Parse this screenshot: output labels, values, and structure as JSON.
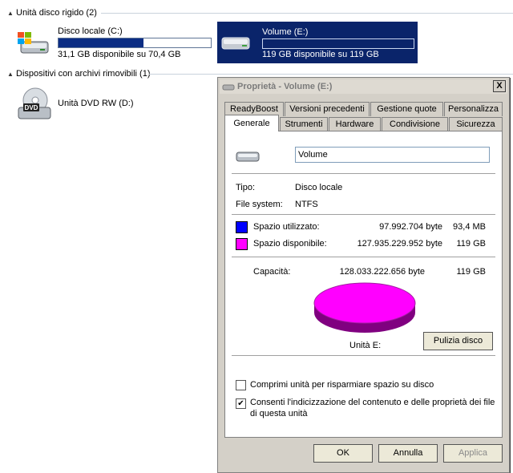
{
  "explorer": {
    "groups": [
      {
        "title": "Unità disco rigido (2)"
      },
      {
        "title": "Dispositivi con archivi rimovibili (1)"
      }
    ],
    "drives": [
      {
        "name": "Disco locale (C:)",
        "space": "31,1 GB disponibile su 70,4 GB",
        "used_fraction": 0.56
      },
      {
        "name": "Volume (E:)",
        "space": "119 GB disponibile su 119 GB",
        "used_fraction": 0.0
      },
      {
        "name": "Unità DVD RW (D:)",
        "icon_label": "DVD"
      }
    ]
  },
  "dialog": {
    "title": "Proprietà - Volume (E:)",
    "close_label": "X",
    "tabs_row1": [
      "ReadyBoost",
      "Versioni precedenti",
      "Gestione quote",
      "Personalizza"
    ],
    "tabs_row2": [
      "Generale",
      "Strumenti",
      "Hardware",
      "Condivisione",
      "Sicurezza"
    ],
    "active_tab": "Generale",
    "volume_name": "Volume",
    "type_label": "Tipo:",
    "type_value": "Disco locale",
    "fs_label": "File system:",
    "fs_value": "NTFS",
    "used": {
      "label": "Spazio utilizzato:",
      "bytes": "97.992.704 byte",
      "size": "93,4 MB",
      "color": "#0000ff"
    },
    "free": {
      "label": "Spazio disponibile:",
      "bytes": "127.935.229.952 byte",
      "size": "119 GB",
      "color": "#ff00ff"
    },
    "capacity": {
      "label": "Capacità:",
      "bytes": "128.033.222.656 byte",
      "size": "119 GB"
    },
    "drive_label": "Unità E:",
    "cleanup_button": "Pulizia disco",
    "compress_label": "Comprimi unità per risparmiare spazio su disco",
    "compress_checked": false,
    "index_label_line1": "Consenti l'indicizzazione del contenuto e delle proprietà dei file",
    "index_label_line2": "di questa unità",
    "index_checked": true,
    "ok_button": "OK",
    "cancel_button": "Annulla",
    "apply_button": "Applica"
  }
}
